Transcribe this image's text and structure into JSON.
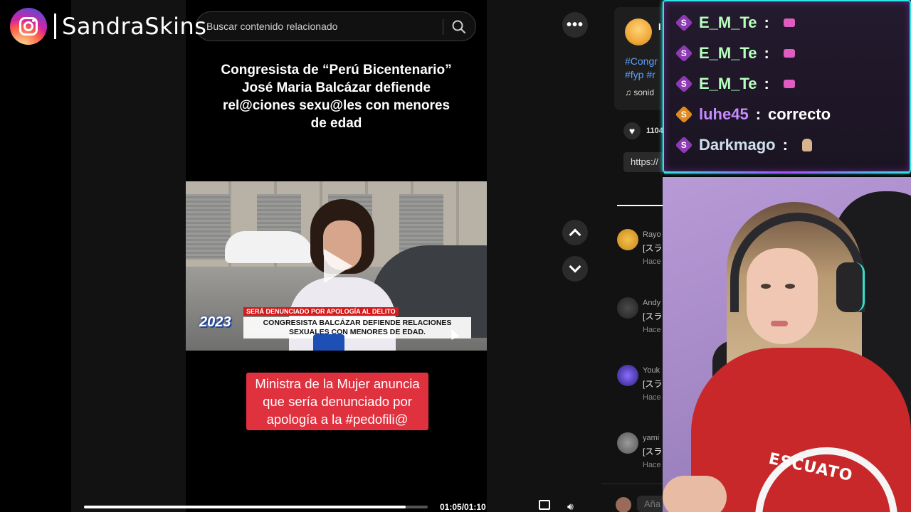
{
  "brand": {
    "name": "SandraSkins"
  },
  "search": {
    "placeholder": "Buscar contenido relacionado"
  },
  "video": {
    "caption_top": "Congresista de “Perú Bicentenario” José Maria Balcázar defiende rel@ciones sexu@les con menores de edad",
    "news_tag": "SERÁ DENUNCIADO POR APOLOGÍA AL DELITO",
    "news_headline": "CONGRESISTA BALCÁZAR DEFIENDE RELACIONES SEXUALES CON MENORES DE EDAD.",
    "year_tag": "2023",
    "caption_bottom": "Ministra de la Mujer anuncia que sería denunciado por apología a la #pedofili@",
    "time": "01:05/01:10",
    "progress": 0.935
  },
  "side": {
    "author_initial": "I",
    "hashtags": [
      "#Congr",
      "#fyp #r"
    ],
    "music": "♫ sonid",
    "likes": "1104",
    "link": "https://",
    "comments_tab": "C",
    "comments": [
      {
        "name": "Rayo",
        "text": "[スラ",
        "time": "Hace"
      },
      {
        "name": "Andy",
        "text": "[スラ",
        "time": "Hace"
      },
      {
        "name": "Youk",
        "text": "[スラ",
        "time": "Hace"
      },
      {
        "name": "yami",
        "text": "[スラ",
        "time": "Hace"
      }
    ],
    "add_comment_placeholder": "Aña"
  },
  "chat": [
    {
      "user": "E_M_Te",
      "message": "",
      "user_color": "#b8ffbf",
      "badge_color": "#8e3ab4",
      "badge_letter": "S",
      "emote": "pink"
    },
    {
      "user": "E_M_Te",
      "message": "",
      "user_color": "#b8ffbf",
      "badge_color": "#8e3ab4",
      "badge_letter": "S",
      "emote": "pink"
    },
    {
      "user": "E_M_Te",
      "message": "",
      "user_color": "#b8ffbf",
      "badge_color": "#8e3ab4",
      "badge_letter": "S",
      "emote": "pink"
    },
    {
      "user": "luhe45",
      "message": "correcto",
      "user_color": "#c58cff",
      "badge_color": "#e08a1e",
      "badge_letter": "S",
      "emote": ""
    },
    {
      "user": "Darkmago",
      "message": "",
      "user_color": "#cfe0ef",
      "badge_color": "#8e3ab4",
      "badge_letter": "S",
      "emote": "figure"
    }
  ],
  "webcam": {
    "shirt_text": "ESCUATO"
  },
  "colors": {
    "accent_cyan": "#2ee6e6",
    "caption_red": "#e0313f",
    "hashtag_blue": "#5ea0ff"
  }
}
